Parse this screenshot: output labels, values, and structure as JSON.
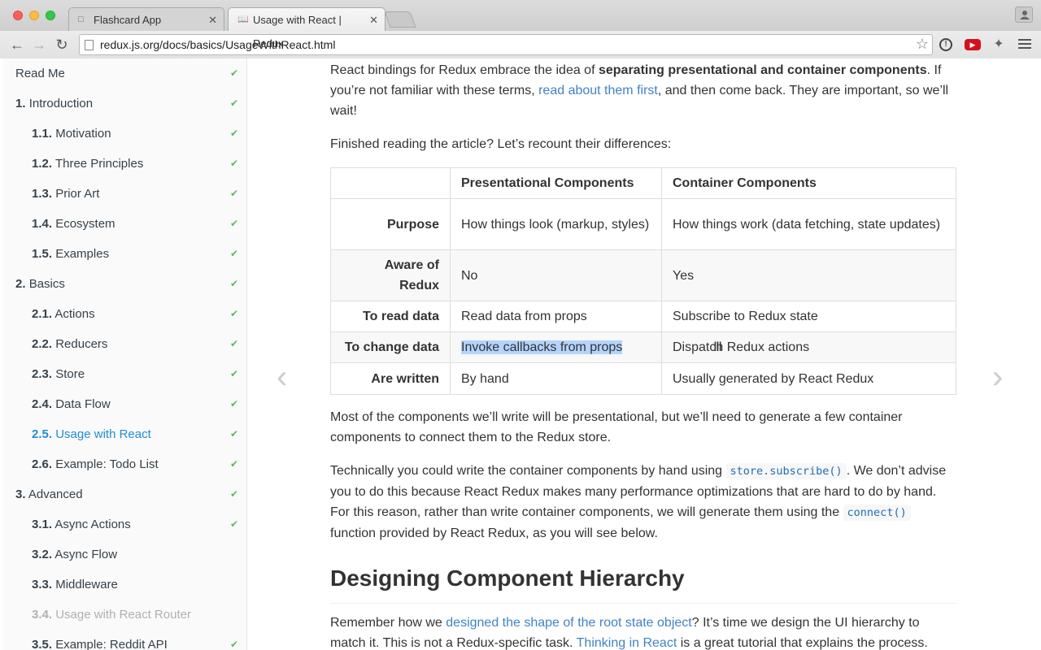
{
  "browser": {
    "tabs": [
      {
        "title": "Flashcard App",
        "active": false
      },
      {
        "title": "Usage with React | Redux",
        "active": true
      }
    ],
    "url": "redux.js.org/docs/basics/UsageWithReact.html"
  },
  "sidebar": {
    "items": [
      {
        "num": "",
        "label": "Read Me",
        "level": 0,
        "state": "done"
      },
      {
        "num": "1.",
        "label": "Introduction",
        "level": 0,
        "state": "done"
      },
      {
        "num": "1.1.",
        "label": "Motivation",
        "level": 1,
        "state": "done"
      },
      {
        "num": "1.2.",
        "label": "Three Principles",
        "level": 1,
        "state": "done"
      },
      {
        "num": "1.3.",
        "label": "Prior Art",
        "level": 1,
        "state": "done"
      },
      {
        "num": "1.4.",
        "label": "Ecosystem",
        "level": 1,
        "state": "done"
      },
      {
        "num": "1.5.",
        "label": "Examples",
        "level": 1,
        "state": "done"
      },
      {
        "num": "2.",
        "label": "Basics",
        "level": 0,
        "state": "done"
      },
      {
        "num": "2.1.",
        "label": "Actions",
        "level": 1,
        "state": "done"
      },
      {
        "num": "2.2.",
        "label": "Reducers",
        "level": 1,
        "state": "done"
      },
      {
        "num": "2.3.",
        "label": "Store",
        "level": 1,
        "state": "done"
      },
      {
        "num": "2.4.",
        "label": "Data Flow",
        "level": 1,
        "state": "done"
      },
      {
        "num": "2.5.",
        "label": "Usage with React",
        "level": 1,
        "state": "active"
      },
      {
        "num": "2.6.",
        "label": "Example: Todo List",
        "level": 1,
        "state": "done"
      },
      {
        "num": "3.",
        "label": "Advanced",
        "level": 0,
        "state": "done"
      },
      {
        "num": "3.1.",
        "label": "Async Actions",
        "level": 1,
        "state": "done"
      },
      {
        "num": "3.2.",
        "label": "Async Flow",
        "level": 1,
        "state": "none"
      },
      {
        "num": "3.3.",
        "label": "Middleware",
        "level": 1,
        "state": "none"
      },
      {
        "num": "3.4.",
        "label": "Usage with React Router",
        "level": 1,
        "state": "disabled"
      },
      {
        "num": "3.5.",
        "label": "Example: Reddit API",
        "level": 1,
        "state": "done"
      }
    ]
  },
  "content": {
    "p1": {
      "before": "React bindings for Redux embrace the idea of ",
      "bold": "separating presentational and container components",
      "mid": ". If you’re not familiar with these terms, ",
      "link": "read about them first",
      "after": ", and then come back. They are important, so we’ll wait!"
    },
    "p2": "Finished reading the article? Let’s recount their differences:",
    "table": {
      "headers": [
        "",
        "Presentational Components",
        "Container Components"
      ],
      "rows": [
        [
          "Purpose",
          "How things look (markup, styles)",
          "How things work (data fetching, state updates)"
        ],
        [
          "Aware of Redux",
          "No",
          "Yes"
        ],
        [
          "To read data",
          "Read data from props",
          "Subscribe to Redux state"
        ],
        [
          "To change data",
          "Invoke callbacks from props",
          "Dispatch Redux actions"
        ],
        [
          "Are written",
          "By hand",
          "Usually generated by React Redux"
        ]
      ]
    },
    "p3": "Most of the components we’ll write will be presentational, but we’ll need to generate a few container components to connect them to the Redux store.",
    "p4": {
      "before": "Technically you could write the container components by hand using ",
      "code1": "store.subscribe()",
      "mid": ". We don’t advise you to do this because React Redux makes many performance optimizations that are hard to do by hand. For this reason, rather than write container components, we will generate them using the ",
      "code2": "connect()",
      "after": " function provided by React Redux, as you will see below."
    },
    "h2": "Designing Component Hierarchy",
    "p5": {
      "before": "Remember how we ",
      "link1": "designed the shape of the root state object",
      "mid": "? It’s time we design the UI hierarchy to match it. This is not a Redux-specific task. ",
      "link2": "Thinking in React",
      "after": " is a great tutorial that explains the process."
    }
  },
  "icons": {
    "prev": "chevron-left-icon",
    "next": "chevron-right-icon",
    "check": "check-icon"
  },
  "colors": {
    "link": "#4183c4",
    "active_nav": "#1f8dd6",
    "check": "#5cb85c",
    "selection": "#b3d4fc"
  }
}
